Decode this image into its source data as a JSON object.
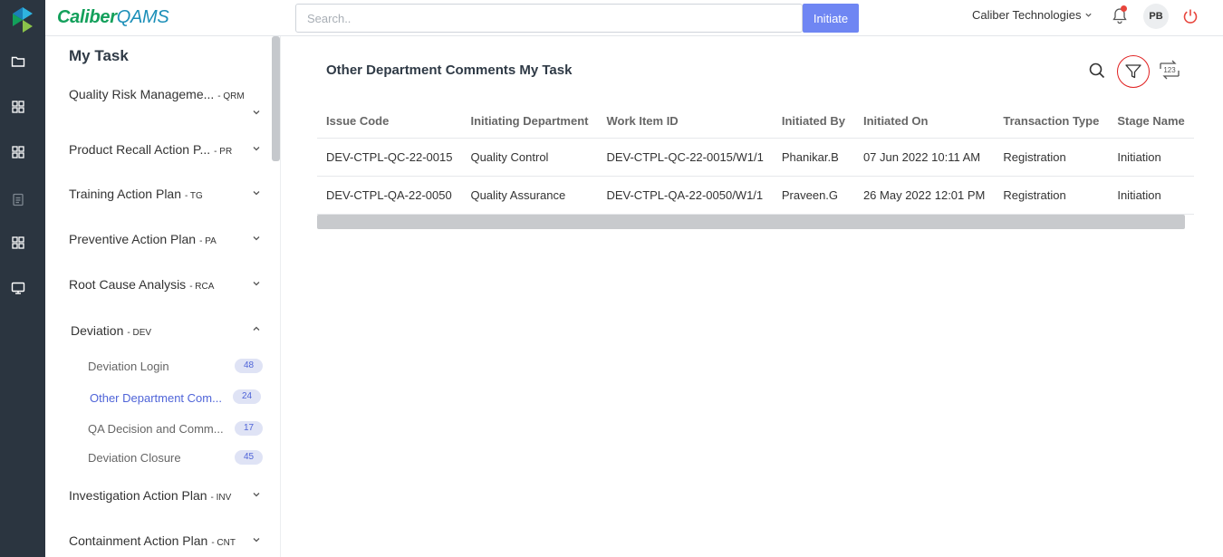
{
  "header": {
    "brand_part1": "Caliber",
    "brand_part2": "QAMS",
    "search_placeholder": "Search..",
    "initiate_label": "Initiate",
    "company": "Caliber Technologies",
    "avatar_initials": "PB"
  },
  "sidebar": {
    "title": "My Task",
    "modules": [
      {
        "label": "Quality Risk Manageme...",
        "code": "- QRM"
      },
      {
        "label": "Product Recall Action P...",
        "code": "- PR"
      },
      {
        "label": "Training Action Plan",
        "code": "- TG"
      },
      {
        "label": "Preventive Action Plan",
        "code": "- PA"
      },
      {
        "label": "Root Cause Analysis",
        "code": "- RCA"
      },
      {
        "label": "Deviation",
        "code": "- DEV"
      },
      {
        "label": "Investigation Action Plan",
        "code": "- INV"
      },
      {
        "label": "Containment Action Plan",
        "code": "- CNT"
      }
    ],
    "deviation_items": [
      {
        "label": "Deviation Login",
        "count": "48"
      },
      {
        "label": "Other Department Com...",
        "count": "24"
      },
      {
        "label": "QA Decision and Comm...",
        "count": "17"
      },
      {
        "label": "Deviation Closure",
        "count": "45"
      }
    ]
  },
  "main": {
    "title": "Other Department Comments My Task",
    "columns": [
      "Issue Code",
      "Initiating Department",
      "Work Item ID",
      "Initiated By",
      "Initiated On",
      "Transaction Type",
      "Stage Name"
    ],
    "rows": [
      [
        "DEV-CTPL-QC-22-0015",
        "Quality Control",
        "DEV-CTPL-QC-22-0015/W1/1",
        "Phanikar.B",
        "07 Jun 2022 10:11 AM",
        "Registration",
        "Initiation"
      ],
      [
        "DEV-CTPL-QA-22-0050",
        "Quality Assurance",
        "DEV-CTPL-QA-22-0050/W1/1",
        "Praveen.G",
        "26 May 2022 12:01 PM",
        "Registration",
        "Initiation"
      ]
    ],
    "refresh_icon_text": "123"
  },
  "colors": {
    "rail_bg": "#2b3540",
    "accent": "#6f86f3",
    "brand_green": "#13a05b",
    "active_link": "#4f64d8",
    "highlight_red": "#e02020"
  },
  "icons": [
    "app-logo-icon",
    "folder-icon",
    "grid-icon",
    "clipboard-icon",
    "monitor-icon",
    "bell-icon",
    "power-icon",
    "search-icon",
    "filter-icon",
    "refresh-counter-icon",
    "chevron-down-icon",
    "chevron-up-icon"
  ]
}
